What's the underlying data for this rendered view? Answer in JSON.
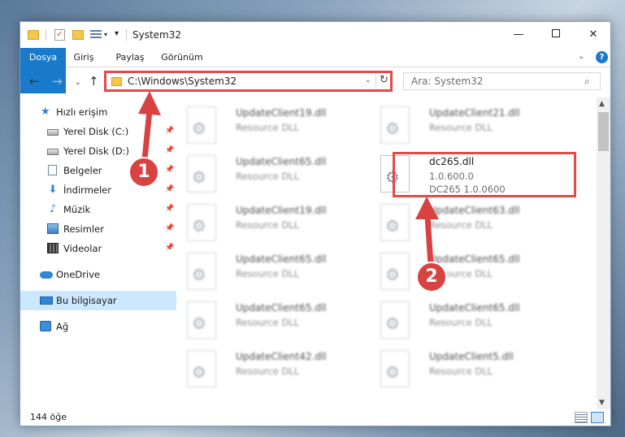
{
  "window": {
    "title": "System32",
    "minimize": "—",
    "close": "✕"
  },
  "quick_access_toolbar": {
    "customize_arrow": "▾",
    "check_glyph": "✓"
  },
  "ribbon": {
    "tabs": [
      "Dosya",
      "Giriş",
      "Paylaş",
      "Görünüm"
    ],
    "expand_glyph": "⌄",
    "help_glyph": "?"
  },
  "nav": {
    "back": "←",
    "forward": "→",
    "recent": "⌄",
    "up": "↑",
    "address": "C:\\Windows\\System32",
    "address_dropdown": "⌄",
    "refresh": "↻",
    "search_placeholder": "Ara: System32",
    "search_glyph": "⌕"
  },
  "sidebar": {
    "pin_glyph": "📌",
    "items": [
      {
        "label": "Hızlı erişim",
        "icon": "star-icon",
        "glyph": "★"
      },
      {
        "label": "Yerel Disk (C:)",
        "icon": "drive-icon"
      },
      {
        "label": "Yerel Disk (D:)",
        "icon": "drive-icon"
      },
      {
        "label": "Belgeler",
        "icon": "documents-icon"
      },
      {
        "label": "İndirmeler",
        "icon": "download-icon",
        "glyph": "⬇"
      },
      {
        "label": "Müzik",
        "icon": "music-icon",
        "glyph": "♪"
      },
      {
        "label": "Resimler",
        "icon": "pictures-icon"
      },
      {
        "label": "Videolar",
        "icon": "videos-icon"
      },
      {
        "label": "OneDrive",
        "icon": "cloud-icon"
      },
      {
        "label": "Bu bilgisayar",
        "icon": "computer-icon"
      },
      {
        "label": "Ağ",
        "icon": "network-icon"
      }
    ]
  },
  "files": [
    {
      "name": "UpdateClient19.dll",
      "line1": "Resource DLL",
      "line2": ""
    },
    {
      "name": "UpdateClient21.dll",
      "line1": "Resource DLL",
      "line2": ""
    },
    {
      "name": "UpdateClient65.dll",
      "line1": "Resource DLL",
      "line2": ""
    },
    {
      "name": "dc265.dll",
      "line1": "1.0.600.0",
      "line2": "DC265 1.0.0600"
    },
    {
      "name": "UpdateClient19.dll",
      "line1": "Resource DLL",
      "line2": ""
    },
    {
      "name": "UpdateClient63.dll",
      "line1": "Resource DLL",
      "line2": ""
    },
    {
      "name": "UpdateClient65.dll",
      "line1": "Resource DLL",
      "line2": ""
    },
    {
      "name": "UpdateClient65.dll",
      "line1": "Resource DLL",
      "line2": ""
    },
    {
      "name": "UpdateClient65.dll",
      "line1": "Resource DLL",
      "line2": ""
    },
    {
      "name": "UpdateClient65.dll",
      "line1": "Resource DLL",
      "line2": ""
    },
    {
      "name": "UpdateClient42.dll",
      "line1": "Resource DLL",
      "line2": ""
    },
    {
      "name": "UpdateClient5.dll",
      "line1": "Resource DLL",
      "line2": ""
    }
  ],
  "scrollbar": {
    "up": "▲",
    "down": "▼"
  },
  "status": {
    "item_count": "144 öğe"
  },
  "annotations": {
    "callout_1": "1",
    "callout_2": "2",
    "color": "#d84242"
  },
  "colors": {
    "accent": "#1979ca",
    "highlight_border": "#e34a4a",
    "selection": "#cce8ff"
  }
}
